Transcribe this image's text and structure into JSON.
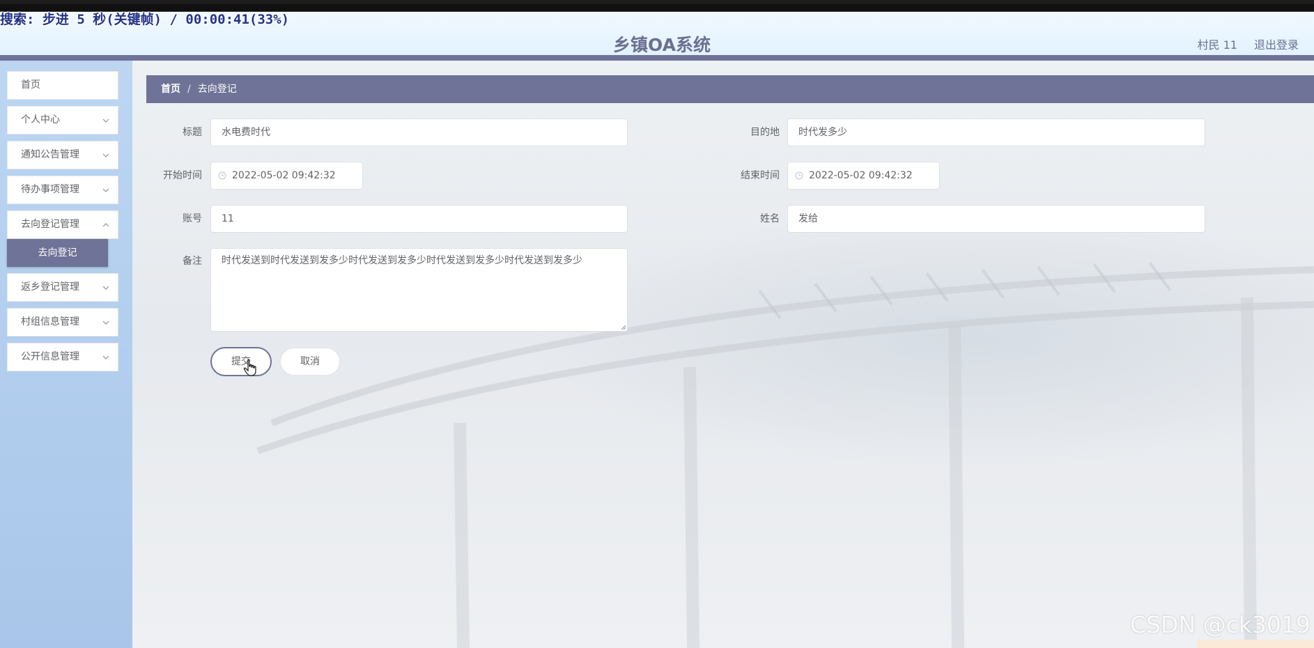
{
  "recording_overlay": "搜索: 步进 5 秒(关键帧) / 00:00:41(33%)",
  "header": {
    "title": "乡镇OA系统",
    "user": "村民 11",
    "logout": "退出登录"
  },
  "sidebar": {
    "items": [
      {
        "label": "首页"
      },
      {
        "label": "个人中心"
      },
      {
        "label": "通知公告管理"
      },
      {
        "label": "待办事项管理"
      },
      {
        "label": "去向登记管理"
      },
      {
        "label": "返乡登记管理"
      },
      {
        "label": "村组信息管理"
      },
      {
        "label": "公开信息管理"
      }
    ],
    "active_sub": "去向登记"
  },
  "breadcrumb": {
    "home": "首页",
    "separator": "/",
    "current": "去向登记"
  },
  "form": {
    "title_label": "标题",
    "title_value": "水电费时代",
    "destination_label": "目的地",
    "destination_value": "时代发多少",
    "start_label": "开始时间",
    "start_value": "2022-05-02 09:42:32",
    "end_label": "结束时间",
    "end_value": "2022-05-02 09:42:32",
    "account_label": "账号",
    "account_value": "11",
    "name_label": "姓名",
    "name_value": "发给",
    "remark_label": "备注",
    "remark_value": "时代发送到时代发送到发多少时代发送到发多少时代发送到发多少时代发送到发多少",
    "submit": "提交",
    "cancel": "取消"
  },
  "watermark": "CSDN @ck3019",
  "colors": {
    "accent": "#6e7397",
    "header_bg": "#e8f4ff",
    "sidebar_bg": "#b3cdee"
  }
}
